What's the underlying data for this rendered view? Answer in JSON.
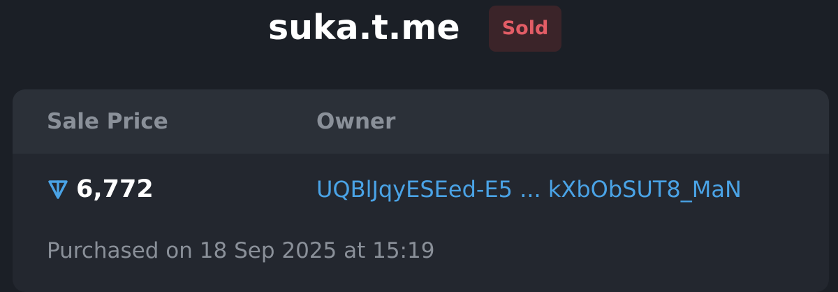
{
  "header": {
    "domain": "suka.t.me",
    "status": "Sold"
  },
  "card": {
    "sale_price_label": "Sale Price",
    "owner_label": "Owner",
    "price": "6,772",
    "currency_icon": "ton-icon",
    "owner_address": "UQBlJqyESEed-E5 ... kXbObSUT8_MaN",
    "purchased": "Purchased on 18 Sep 2025 at 15:19"
  },
  "colors": {
    "background": "#1b1f26",
    "card": "#23272f",
    "card_header": "#2b3038",
    "link": "#4aa3e6",
    "sold_badge_bg": "#3b2429",
    "sold_badge_text": "#e35d66",
    "muted_text": "#8a9099"
  }
}
